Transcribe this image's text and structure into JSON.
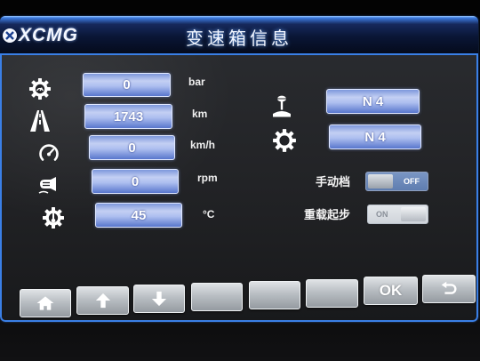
{
  "header": {
    "logo_text": "XCMG",
    "title": "变速箱信息"
  },
  "readings": [
    {
      "icon": "pressure-gear-icon",
      "value": "0",
      "unit": "bar"
    },
    {
      "icon": "road-distance-icon",
      "value": "1743",
      "unit": "km"
    },
    {
      "icon": "speedometer-icon",
      "value": "0",
      "unit": "km/h"
    },
    {
      "icon": "engine-rpm-icon",
      "value": "0",
      "unit": "rpm"
    },
    {
      "icon": "transmission-temperature-icon",
      "value": "45",
      "unit": "°C"
    }
  ],
  "gears": [
    {
      "icon": "shift-lever-icon",
      "value": "N 4"
    },
    {
      "icon": "gear-icon",
      "value": "N 4"
    }
  ],
  "switches": [
    {
      "label": "手动档",
      "state": "OFF"
    },
    {
      "label": "重载起步",
      "state": "ON"
    }
  ],
  "softkeys": [
    {
      "icon": "home-icon"
    },
    {
      "icon": "up-arrow-icon"
    },
    {
      "icon": "down-arrow-icon"
    },
    {},
    {},
    {},
    {
      "label": "OK"
    },
    {
      "icon": "return-icon"
    }
  ],
  "colors": {
    "header_bg": "#0a1636",
    "accent_border": "#3a7fe6",
    "screen_bg": "#222326",
    "value_box": "#c3cff3",
    "toggle_off": "#5f7db0",
    "toggle_on": "#cfd4da",
    "softkey": "#b9bec3"
  }
}
